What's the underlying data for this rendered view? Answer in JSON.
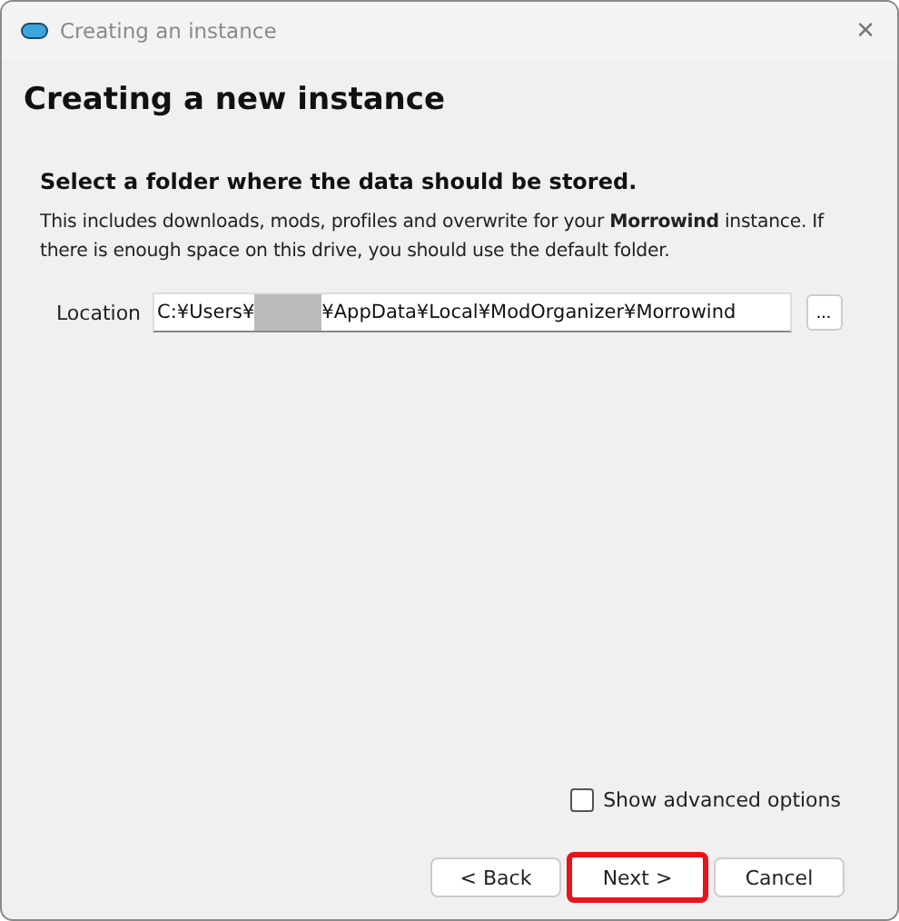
{
  "window": {
    "title": "Creating an instance",
    "close": "✕"
  },
  "page": {
    "title": "Creating a new instance",
    "heading": "Select a folder where the data should be stored.",
    "description": "This includes downloads, mods, profiles and overwrite for your **Morrowind** instance. If there is enough space on this drive, you should use the default folder."
  },
  "location": {
    "label": "Location",
    "value_start": "C:¥Users¥",
    "redacted": true,
    "value_end": "¥AppData¥Local¥ModOrganizer¥Morrowind",
    "browse": "..."
  },
  "advanced": {
    "label": "Show advanced options",
    "checked": false
  },
  "buttons": [
    {
      "label": "< Back",
      "highlighted": false
    },
    {
      "label": "Next >",
      "highlighted": true
    },
    {
      "label": "Cancel",
      "highlighted": false
    }
  ]
}
